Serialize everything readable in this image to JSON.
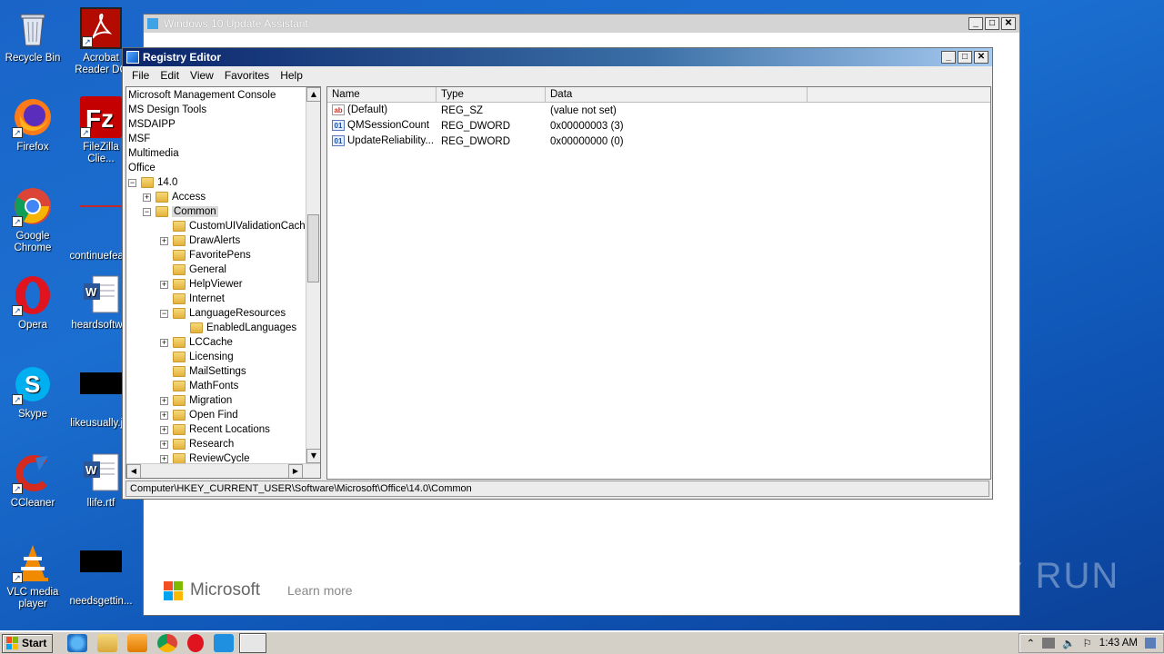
{
  "desktop": {
    "icons": [
      {
        "label": "Recycle Bin"
      },
      {
        "label": "Acrobat Reader DC"
      },
      {
        "label": "Firefox"
      },
      {
        "label": "FileZilla Clie..."
      },
      {
        "label": "Google Chrome"
      },
      {
        "label": "continuefea..."
      },
      {
        "label": "Opera"
      },
      {
        "label": "heardsoftw..."
      },
      {
        "label": "Skype"
      },
      {
        "label": "likeusually.j..."
      },
      {
        "label": "CCleaner"
      },
      {
        "label": "llife.rtf"
      },
      {
        "label": "VLC media player"
      },
      {
        "label": "needsgettin..."
      }
    ]
  },
  "update_assistant": {
    "title": "Windows 10 Update Assistant",
    "brand": "Microsoft",
    "learn_more": "Learn more"
  },
  "registry_editor": {
    "title": "Registry Editor",
    "menu": [
      "File",
      "Edit",
      "View",
      "Favorites",
      "Help"
    ],
    "tree": [
      {
        "label": "Microsoft Management Console"
      },
      {
        "label": "MS Design Tools"
      },
      {
        "label": "MSDAIPP"
      },
      {
        "label": "MSF"
      },
      {
        "label": "Multimedia"
      },
      {
        "label": "Office"
      },
      {
        "label": "14.0"
      },
      {
        "label": "Access"
      },
      {
        "label": "Common"
      },
      {
        "label": "CustomUIValidationCache"
      },
      {
        "label": "DrawAlerts"
      },
      {
        "label": "FavoritePens"
      },
      {
        "label": "General"
      },
      {
        "label": "HelpViewer"
      },
      {
        "label": "Internet"
      },
      {
        "label": "LanguageResources"
      },
      {
        "label": "EnabledLanguages"
      },
      {
        "label": "LCCache"
      },
      {
        "label": "Licensing"
      },
      {
        "label": "MailSettings"
      },
      {
        "label": "MathFonts"
      },
      {
        "label": "Migration"
      },
      {
        "label": "Open Find"
      },
      {
        "label": "Recent Locations"
      },
      {
        "label": "Research"
      },
      {
        "label": "ReviewCycle"
      }
    ],
    "columns": [
      "Name",
      "Type",
      "Data"
    ],
    "values": [
      {
        "name": "(Default)",
        "type": "REG_SZ",
        "data": "(value not set)",
        "icon": "string-value-icon"
      },
      {
        "name": "QMSessionCount",
        "type": "REG_DWORD",
        "data": "0x00000003 (3)",
        "icon": "dword-value-icon"
      },
      {
        "name": "UpdateReliability...",
        "type": "REG_DWORD",
        "data": "0x00000000 (0)",
        "icon": "dword-value-icon"
      }
    ],
    "status_path": "Computer\\HKEY_CURRENT_USER\\Software\\Microsoft\\Office\\14.0\\Common"
  },
  "taskbar": {
    "start_label": "Start",
    "clock": "1:43 AM"
  },
  "watermark": "ANY RUN"
}
